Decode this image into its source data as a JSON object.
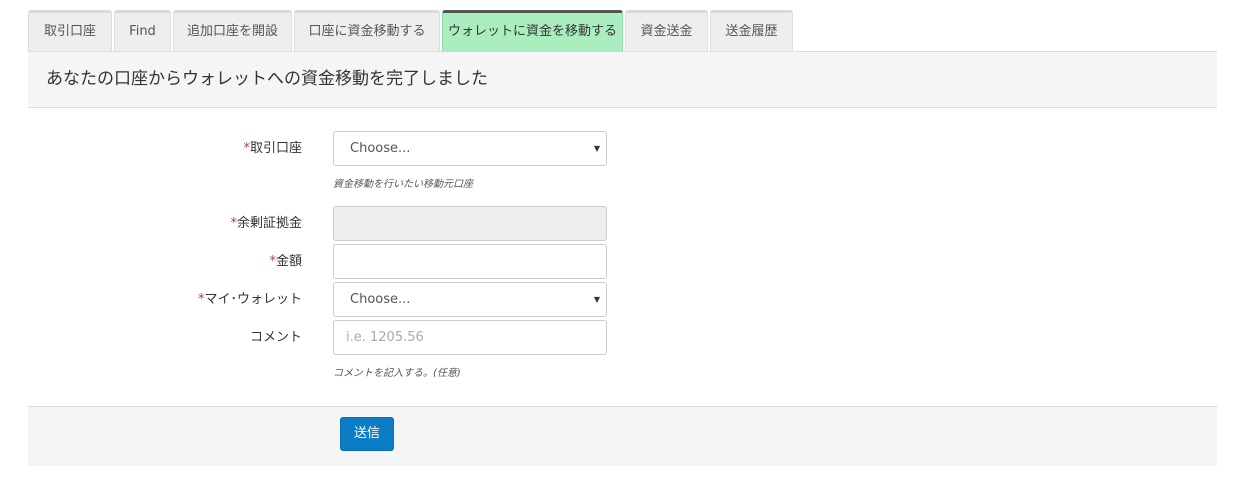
{
  "tabs": [
    {
      "label": "取引口座",
      "active": false
    },
    {
      "label": "Find",
      "active": false
    },
    {
      "label": "追加口座を開設",
      "active": false
    },
    {
      "label": "口座に資金移動する",
      "active": false
    },
    {
      "label": "ウォレットに資金を移動する",
      "active": true
    },
    {
      "label": "資金送金",
      "active": false
    },
    {
      "label": "送金履歴",
      "active": false
    }
  ],
  "heading": "あなたの口座からウォレットへの資金移動を完了しました",
  "form": {
    "required_mark": "*",
    "account": {
      "label": "取引口座",
      "value": "Choose...",
      "help": "資金移動を行いたい移動元口座"
    },
    "margin": {
      "label": "余剰証拠金",
      "value": ""
    },
    "amount": {
      "label": "金額",
      "value": ""
    },
    "wallet": {
      "label": "マイ･ウォレット",
      "value": "Choose..."
    },
    "comment": {
      "label": "コメント",
      "placeholder": "i.e. 1205.56",
      "help": "コメントを記入する。(任意)"
    }
  },
  "submit_label": "送信",
  "icons": {
    "caret": "▼"
  },
  "colors": {
    "active_tab": "#aaeec0",
    "submit_button": "#0b7dc7",
    "required": "#a94442"
  }
}
